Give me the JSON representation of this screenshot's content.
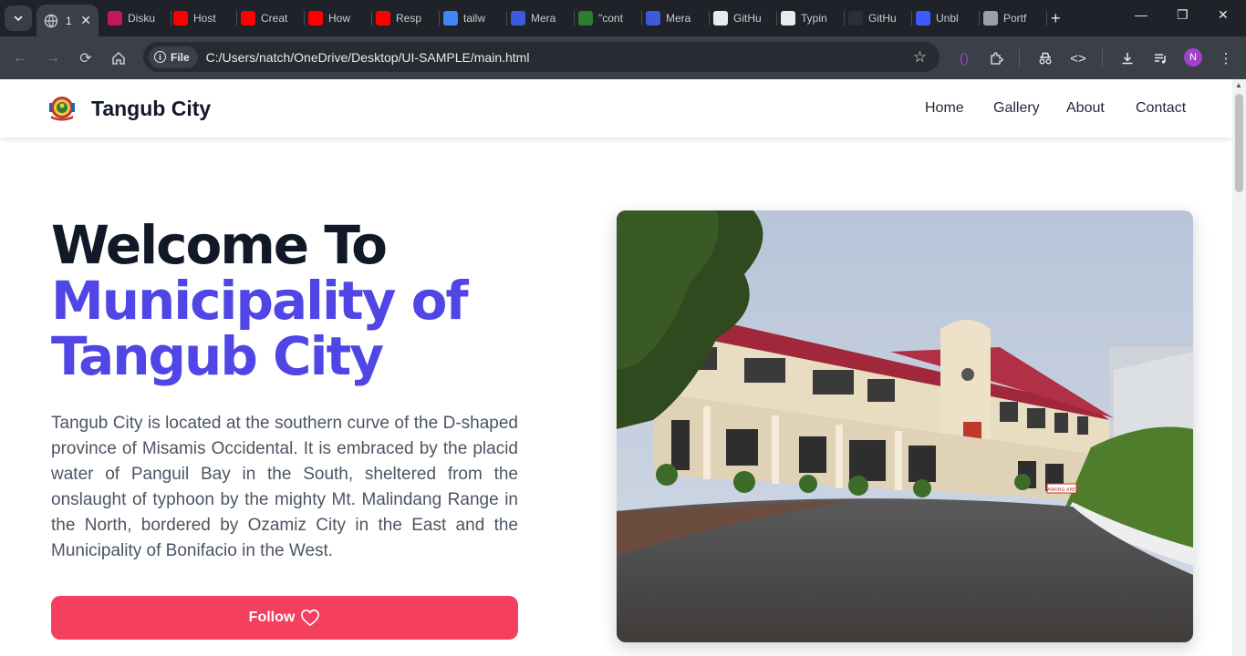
{
  "browser": {
    "active_tab": {
      "title": "1",
      "favicon": "globe-icon"
    },
    "tabs": [
      {
        "title": "Disku",
        "color": "#c2185b"
      },
      {
        "title": "Host",
        "color": "#ff0000"
      },
      {
        "title": "Creat",
        "color": "#ff0000"
      },
      {
        "title": "How",
        "color": "#ff0000"
      },
      {
        "title": "Resp",
        "color": "#ff0000"
      },
      {
        "title": "tailw",
        "color": "#4285f4"
      },
      {
        "title": "Mera",
        "color": "#3b5bdb"
      },
      {
        "title": "\"cont",
        "color": "#2e7d32"
      },
      {
        "title": "Mera",
        "color": "#3b5bdb"
      },
      {
        "title": "GitHu",
        "color": "#e8eaed"
      },
      {
        "title": "Typin",
        "color": "#e8eaed"
      },
      {
        "title": "GitHu",
        "color": "#2b2f36"
      },
      {
        "title": "Unbl",
        "color": "#3d5afe"
      },
      {
        "title": "Portf",
        "color": "#9aa0a6"
      }
    ],
    "new_tab_label": "+",
    "file_chip": "File",
    "url": "C:/Users/natch/OneDrive/Desktop/UI-SAMPLE/main.html",
    "profile_initial": "N"
  },
  "site": {
    "brand": "Tangub City",
    "nav": [
      "Home",
      "Gallery",
      "About",
      "Contact"
    ],
    "hero": {
      "title_line1": "Welcome To",
      "title_line2": "Municipality of",
      "title_line3": "Tangub City",
      "description": "Tangub City is located at the southern curve of the D-shaped province of Misamis Occidental. It is embraced by the placid water of Panguil Bay in the South, sheltered from the onslaught of typhoon by the mighty Mt. Malindang Range in the North, bordered by Ozamiz City in the East and the Municipality of Bonifacio in the West.",
      "button_label": "Follow",
      "image_alt": "Tangub City Hall"
    },
    "colors": {
      "accent": "#4f46e5",
      "button": "#f43f5e",
      "heading": "#111827"
    },
    "image_signs": {
      "parking_sign": "PARKING AREA"
    }
  }
}
